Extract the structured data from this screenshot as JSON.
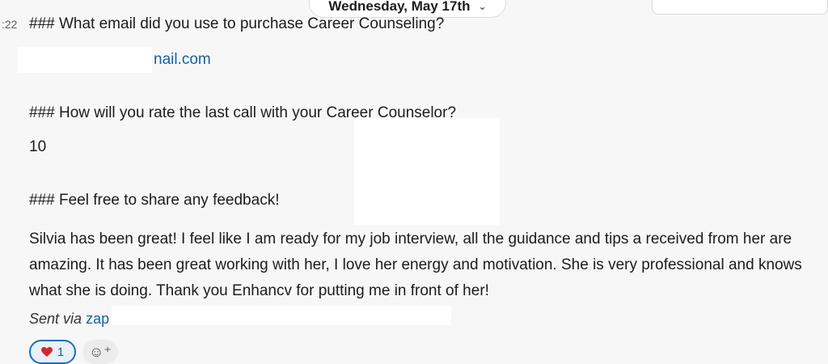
{
  "date_divider": {
    "label": "Wednesday, May 17th"
  },
  "message": {
    "timestamp": ":22",
    "q1": "### What email did you use to purchase Career Counseling?",
    "email_visible": "nail.com",
    "q2": "### How will you rate the last call with your Career Counselor?",
    "rating": "10",
    "q3": "### Feel free to share any feedback!",
    "feedback": "Silvia has been great! I feel like I am ready for my job interview, all the guidance and tips a received from her are amazing. It has been great working with her, I love her energy and motivation. She is very professional and knows what she is doing. Thank you Enhancv for putting me in front of her!",
    "sent_via_label": "Sent via",
    "sent_via_url": "zap"
  },
  "reactions": [
    {
      "emoji": "heart",
      "count": "1"
    }
  ],
  "icons": [
    "chevron-down-icon",
    "add-reaction-icon",
    "heart-icon"
  ],
  "colors": {
    "link": "#1264a3",
    "reaction_border": "#1d6fbd"
  }
}
